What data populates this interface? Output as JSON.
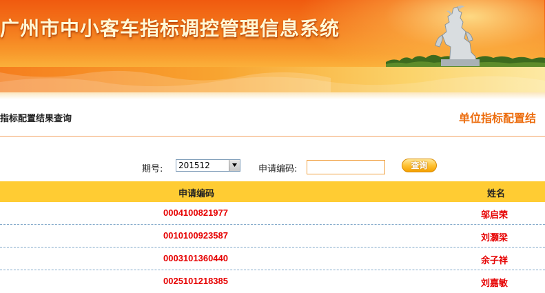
{
  "header": {
    "title": "广州市中小客车指标调控管理信息系统"
  },
  "titlebar": {
    "left": "指标配置结果查询",
    "right": "单位指标配置结"
  },
  "search": {
    "period_label": "期号:",
    "period_value": "201512",
    "appcode_label": "申请编码:",
    "appcode_value": "",
    "button_label": "查询"
  },
  "table": {
    "columns": [
      "申请编码",
      "姓名"
    ],
    "rows": [
      {
        "code": "0004100821977",
        "name": "邬启荣"
      },
      {
        "code": "0010100923587",
        "name": "刘灏梁"
      },
      {
        "code": "0003101360440",
        "name": "余子祥"
      },
      {
        "code": "0025101218385",
        "name": "刘嘉敏"
      }
    ]
  },
  "colors": {
    "banner": "#f05a0f",
    "accent": "#ec6d0f",
    "table_header": "#ffcc33",
    "row_text": "#e60000"
  },
  "icons": {
    "select": "chevron-down-icon",
    "statue": "five-rams-statue-icon"
  }
}
